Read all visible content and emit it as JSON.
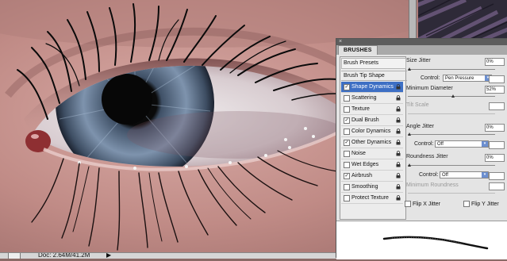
{
  "status_bar": {
    "zoom_label": "",
    "doc_info": "Doc: 2.64M/41.2M",
    "arrow": "▶"
  },
  "panel": {
    "title": "BRUSHES",
    "brush_presets": "Brush Presets",
    "brush_tip_shape": "Brush Tip Shape",
    "options": [
      {
        "label": "Shape Dynamics",
        "checked": true,
        "active": true
      },
      {
        "label": "Scattering",
        "checked": false,
        "active": false
      },
      {
        "label": "Texture",
        "checked": false,
        "active": false
      },
      {
        "label": "Dual Brush",
        "checked": true,
        "active": false
      },
      {
        "label": "Color Dynamics",
        "checked": false,
        "active": false
      },
      {
        "label": "Other Dynamics",
        "checked": true,
        "active": false
      },
      {
        "label": "Noise",
        "checked": false,
        "active": false
      },
      {
        "label": "Wet Edges",
        "checked": false,
        "active": false
      },
      {
        "label": "Airbrush",
        "checked": true,
        "active": false
      },
      {
        "label": "Smoothing",
        "checked": false,
        "active": false
      },
      {
        "label": "Protect Texture",
        "checked": false,
        "active": false
      }
    ],
    "size_jitter": {
      "label": "Size Jitter",
      "value": "0%",
      "fraction": 0.0
    },
    "size_control": {
      "label": "Control:",
      "value": "Pen Pressure"
    },
    "min_diameter": {
      "label": "Minimum Diameter",
      "value": "52%",
      "fraction": 0.52
    },
    "tilt_scale": {
      "label": "Tilt Scale"
    },
    "angle_jitter": {
      "label": "Angle Jitter",
      "value": "0%",
      "fraction": 0.0
    },
    "angle_control": {
      "label": "Control:",
      "value": "Off"
    },
    "roundness_jitter": {
      "label": "Roundness Jitter",
      "value": "0%",
      "fraction": 0.0
    },
    "roundness_control": {
      "label": "Control:",
      "value": "Off"
    },
    "min_roundness": {
      "label": "Minimum Roundness"
    },
    "flip_x": {
      "label": "Flip X Jitter",
      "checked": false
    },
    "flip_y": {
      "label": "Flip Y Jitter",
      "checked": false
    }
  },
  "colors": {
    "skin": "#c99a95",
    "iris": "#5f7690",
    "active_row": "#3d6fc4"
  },
  "icons": {
    "lock": "lock-icon",
    "dropdown": "dropdown-arrow-icon",
    "close": "close-icon"
  }
}
